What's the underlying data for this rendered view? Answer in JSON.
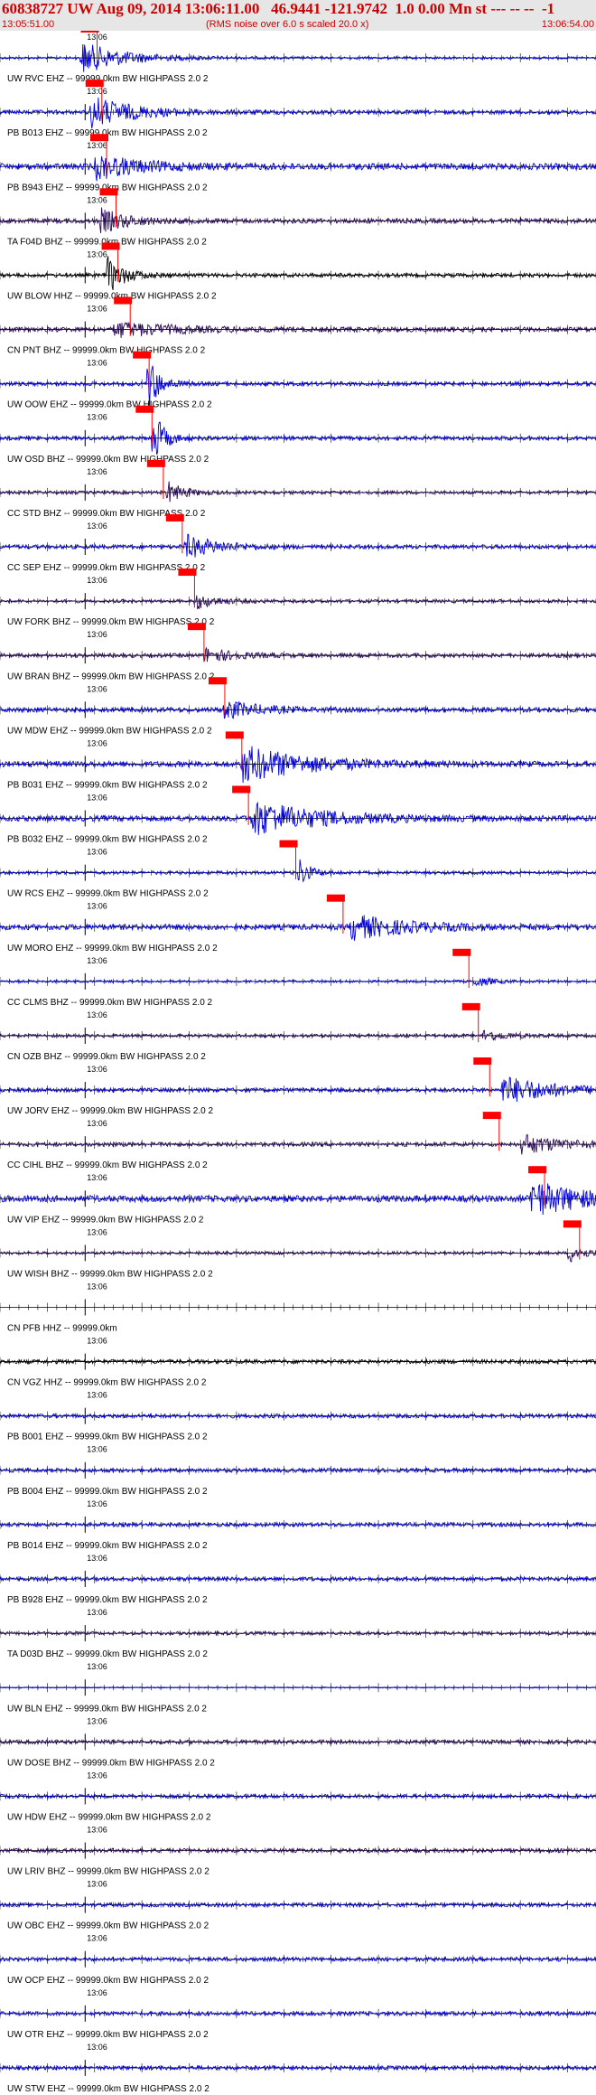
{
  "header": {
    "title": "60838727 UW Aug 09, 2014 13:06:11.00   46.9441 -121.9742  1.0 0.00 Mn st --- -- --  -1",
    "start_time": "13:05:51.00",
    "rms_note": "(RMS noise over 6.0 s scaled 20.0 x)",
    "end_time": "13:06:54.00"
  },
  "colors": {
    "header_bg": "#e6e6e6",
    "header_text": "#cc0000",
    "trace_blue": "#0000dd",
    "trace_purple": "#2a0a5a",
    "trace_black": "#000000",
    "pick_red": "#ff0000"
  },
  "chart_data": {
    "type": "seismogram",
    "x_range": [
      "13:05:51.00",
      "13:06:54.00"
    ],
    "minute_mark": "13:06",
    "tick_interval_s": 1,
    "traces": [
      {
        "label": "UW RVC EHZ -- 99999.0km BW  HIGHPASS  2.0  2",
        "color": "blue",
        "amp": 0.6,
        "burst_t": 8.5,
        "burst_amp": 4.0,
        "burst_dur": 8,
        "pick_t": 9.5
      },
      {
        "label": "PB B013 EHZ -- 99999.0km BW  HIGHPASS  2.0  2",
        "color": "blue",
        "amp": 1.0,
        "burst_t": 9.5,
        "burst_amp": 4.0,
        "burst_dur": 8,
        "pick_t": 10.0
      },
      {
        "label": "PB B943 EHZ -- 99999.0km BW  HIGHPASS  2.0  2",
        "color": "blue",
        "amp": 1.6,
        "burst_t": 10.0,
        "burst_amp": 3.0,
        "burst_dur": 8,
        "pick_t": 10.5
      },
      {
        "label": "TA F04D BHZ -- 99999.0km BW  HIGHPASS  2.0  2",
        "color": "purple",
        "amp": 1.2,
        "burst_t": 10.5,
        "burst_amp": 3.0,
        "burst_dur": 5,
        "pick_t": 11.5
      },
      {
        "label": "UW BLOW HHZ -- 99999.0km BW  HIGHPASS  2.0  2",
        "color": "black",
        "amp": 1.0,
        "burst_t": 11.2,
        "burst_amp": 5.0,
        "burst_dur": 3,
        "pick_t": 11.7
      },
      {
        "label": "CN PNT BHZ -- 99999.0km BW  HIGHPASS  2.0  2",
        "color": "purple",
        "amp": 1.2,
        "burst_t": 12.0,
        "burst_amp": 2.0,
        "burst_dur": 10,
        "pick_t": 13.0
      },
      {
        "label": "UW OOW EHZ -- 99999.0km BW  HIGHPASS  2.0  2",
        "color": "blue",
        "amp": 1.0,
        "burst_t": 15.5,
        "burst_amp": 8.0,
        "burst_dur": 2,
        "pick_t": 15.0
      },
      {
        "label": "UW OSD BHZ -- 99999.0km BW  HIGHPASS  2.0  2",
        "color": "blue",
        "amp": 1.0,
        "burst_t": 16.0,
        "burst_amp": 8.0,
        "burst_dur": 2,
        "pick_t": 15.3
      },
      {
        "label": "CC STD BHZ -- 99999.0km BW  HIGHPASS  2.0  2",
        "color": "purple",
        "amp": 0.8,
        "burst_t": 17.5,
        "burst_amp": 3.0,
        "burst_dur": 3,
        "pick_t": 16.5
      },
      {
        "label": "CC SEP EHZ -- 99999.0km BW  HIGHPASS  2.0  2",
        "color": "blue",
        "amp": 1.0,
        "burst_t": 19.5,
        "burst_amp": 3.0,
        "burst_dur": 6,
        "pick_t": 18.5
      },
      {
        "label": "UW FORK BHZ -- 99999.0km BW  HIGHPASS  2.0  2",
        "color": "purple",
        "amp": 0.8,
        "burst_t": 20.5,
        "burst_amp": 2.0,
        "burst_dur": 4,
        "pick_t": 19.8
      },
      {
        "label": "UW BRAN BHZ -- 99999.0km BW  HIGHPASS  2.0  2",
        "color": "purple",
        "amp": 1.0,
        "burst_t": 21.5,
        "burst_amp": 2.0,
        "burst_dur": 5,
        "pick_t": 20.8
      },
      {
        "label": "UW MDW EHZ -- 99999.0km BW  HIGHPASS  2.0  2",
        "color": "blue",
        "amp": 1.2,
        "burst_t": 23.5,
        "burst_amp": 2.5,
        "burst_dur": 6,
        "pick_t": 23.0
      },
      {
        "label": "PB B031 EHZ -- 99999.0km BW  HIGHPASS  2.0  2",
        "color": "blue",
        "amp": 1.4,
        "burst_t": 25.5,
        "burst_amp": 4.5,
        "burst_dur": 12,
        "pick_t": 24.8
      },
      {
        "label": "PB B032 EHZ -- 99999.0km BW  HIGHPASS  2.0  2",
        "color": "blue",
        "amp": 1.4,
        "burst_t": 26.5,
        "burst_amp": 4.5,
        "burst_dur": 12,
        "pick_t": 25.5
      },
      {
        "label": "UW RCS EHZ -- 99999.0km BW  HIGHPASS  2.0  2",
        "color": "blue",
        "amp": 0.8,
        "burst_t": 31.5,
        "burst_amp": 4.0,
        "burst_dur": 2,
        "pick_t": 30.5
      },
      {
        "label": "UW MORO EHZ -- 99999.0km BW  HIGHPASS  2.0  2",
        "color": "blue",
        "amp": 1.4,
        "burst_t": 37.0,
        "burst_amp": 3.0,
        "burst_dur": 10,
        "pick_t": 35.5
      },
      {
        "label": "CC CLMS BHZ -- 99999.0km BW  HIGHPASS  2.0  2",
        "color": "blue",
        "amp": 0.6,
        "burst_t": 50.0,
        "burst_amp": 1.5,
        "burst_dur": 3,
        "pick_t": 48.8
      },
      {
        "label": "CN OZB BHZ -- 99999.0km BW  HIGHPASS  2.0  2",
        "color": "purple",
        "amp": 0.8,
        "burst_t": 51.0,
        "burst_amp": 1.5,
        "burst_dur": 4,
        "pick_t": 49.8
      },
      {
        "label": "UW JORV EHZ -- 99999.0km BW  HIGHPASS  2.0  2",
        "color": "blue",
        "amp": 1.0,
        "burst_t": 53.0,
        "burst_amp": 3.5,
        "burst_dur": 10,
        "pick_t": 51.0
      },
      {
        "label": "CC CIHL BHZ -- 99999.0km BW  HIGHPASS  2.0  2",
        "color": "purple",
        "amp": 1.0,
        "burst_t": 55.0,
        "burst_amp": 2.5,
        "burst_dur": 8,
        "pick_t": 52.0
      },
      {
        "label": "UW VIP EHZ -- 99999.0km BW  HIGHPASS  2.0  2",
        "color": "blue",
        "amp": 1.6,
        "burst_t": 56.0,
        "burst_amp": 4.5,
        "burst_dur": 10,
        "pick_t": 56.8
      },
      {
        "label": "UW WISH BHZ -- 99999.0km BW  HIGHPASS  2.0  2",
        "color": "purple",
        "amp": 0.7,
        "burst_t": 60.0,
        "burst_amp": 2.5,
        "burst_dur": 3,
        "pick_t": 60.5
      },
      {
        "label": "CN PFB HHZ -- 99999.0km",
        "color": "none",
        "amp": 0
      },
      {
        "label": "CN VGZ HHZ -- 99999.0km BW  HIGHPASS  2.0  2",
        "color": "black",
        "amp": 1.0
      },
      {
        "label": "PB B001 EHZ -- 99999.0km BW  HIGHPASS  2.0  2",
        "color": "blue",
        "amp": 1.0
      },
      {
        "label": "PB B004 EHZ -- 99999.0km BW  HIGHPASS  2.0  2",
        "color": "blue",
        "amp": 1.0
      },
      {
        "label": "PB B014 EHZ -- 99999.0km BW  HIGHPASS  2.0  2",
        "color": "blue",
        "amp": 1.0
      },
      {
        "label": "PB B928 EHZ -- 99999.0km BW  HIGHPASS  2.0  2",
        "color": "blue",
        "amp": 1.0
      },
      {
        "label": "TA D03D BHZ -- 99999.0km BW  HIGHPASS  2.0  2",
        "color": "purple",
        "amp": 0.8
      },
      {
        "label": "UW BLN EHZ -- 99999.0km BW  HIGHPASS  2.0  2",
        "color": "blue",
        "amp": 0.3
      },
      {
        "label": "UW DOSE BHZ -- 99999.0km BW  HIGHPASS  2.0  2",
        "color": "purple",
        "amp": 1.0
      },
      {
        "label": "UW HDW EHZ -- 99999.0km BW  HIGHPASS  2.0  2",
        "color": "blue",
        "amp": 1.0
      },
      {
        "label": "UW LRIV BHZ -- 99999.0km BW  HIGHPASS  2.0  2",
        "color": "purple",
        "amp": 1.0
      },
      {
        "label": "UW OBC EHZ -- 99999.0km BW  HIGHPASS  2.0  2",
        "color": "blue",
        "amp": 1.0
      },
      {
        "label": "UW OCP EHZ -- 99999.0km BW  HIGHPASS  2.0  2",
        "color": "blue",
        "amp": 1.0
      },
      {
        "label": "UW OTR EHZ -- 99999.0km BW  HIGHPASS  2.0  2",
        "color": "blue",
        "amp": 1.0
      },
      {
        "label": "UW STW EHZ -- 99999.0km BW  HIGHPASS  2.0  2",
        "color": "blue",
        "amp": 1.0
      }
    ]
  }
}
